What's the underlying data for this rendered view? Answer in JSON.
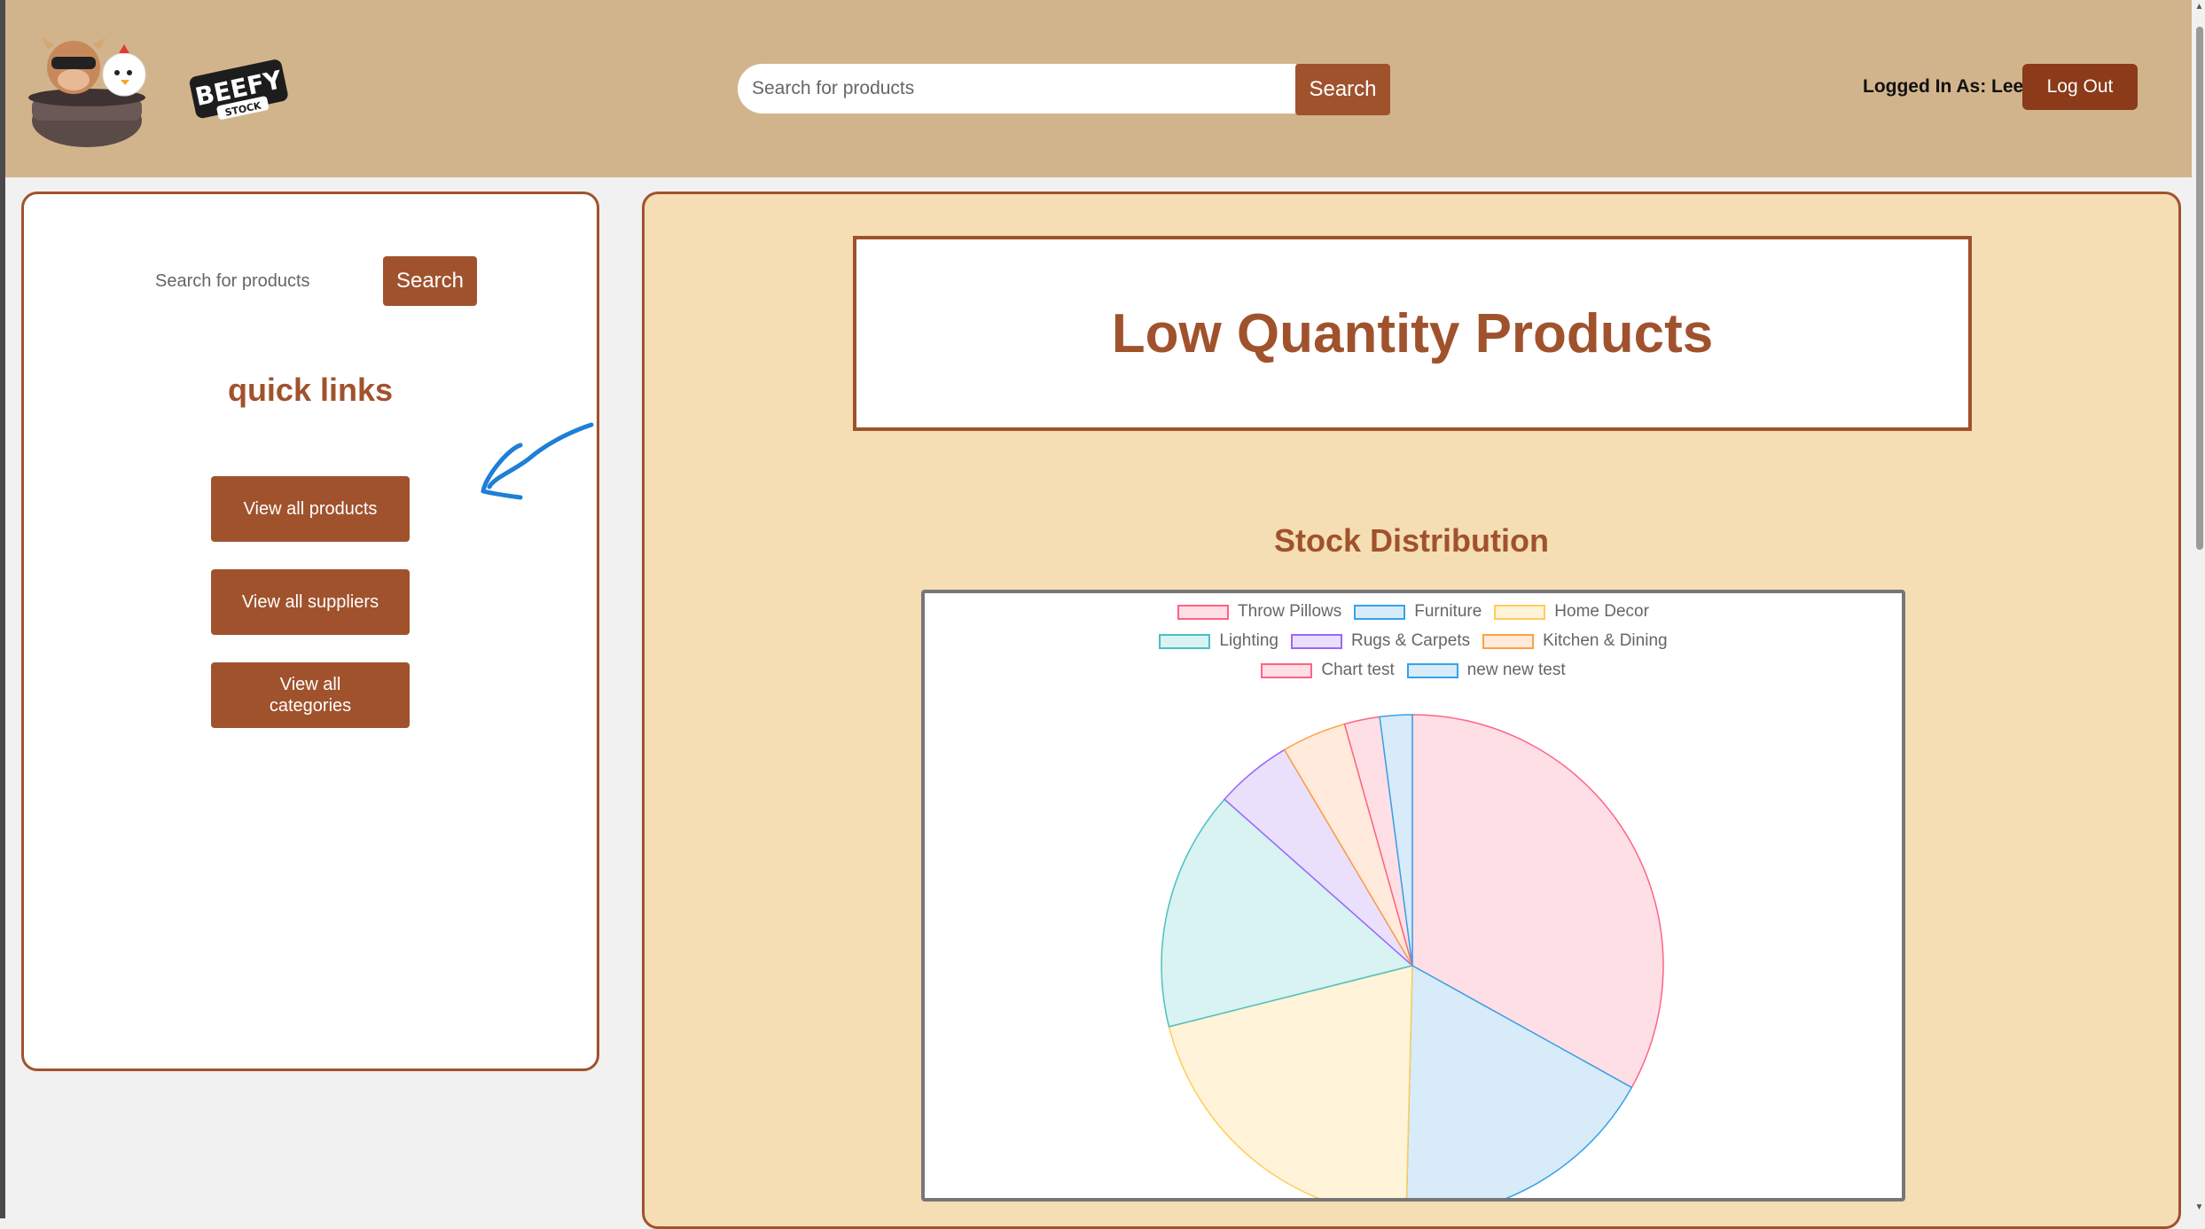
{
  "header": {
    "logo_word": "BEEFY",
    "logo_sub": "STOCK",
    "search_placeholder": "Search for products",
    "search_label": "Search",
    "logged_in_text": "Logged In As: Lee",
    "logout_label": "Log Out"
  },
  "sidebar": {
    "search_placeholder": "Search for products",
    "search_label": "Search",
    "quick_links_title": "quick links",
    "links": [
      {
        "label": "View all products"
      },
      {
        "label": "View all suppliers"
      },
      {
        "label": "View all categories"
      }
    ]
  },
  "main": {
    "page_title": "Low Quantity Products",
    "chart_title": "Stock Distribution"
  },
  "colors": {
    "header_bg": "#d2b48c",
    "brand": "#a0522d",
    "main_bg": "#f5deb3"
  },
  "chart_data": {
    "type": "pie",
    "title": "Stock Distribution",
    "legend_position": "top",
    "categories": [
      "Throw Pillows",
      "Furniture",
      "Home Decor",
      "Lighting",
      "Rugs & Carpets",
      "Kitchen & Dining",
      "Chart test",
      "new new test"
    ],
    "values": [
      33.4,
      17.5,
      20.9,
      15.6,
      5.0,
      4.2,
      2.3,
      2.1
    ],
    "fills": [
      "#ffdfe6",
      "#d8ebf8",
      "#fff3da",
      "#d9f2f2",
      "#ebe0fc",
      "#ffeadb",
      "#ffdfe6",
      "#d8ebf8"
    ],
    "borders": [
      "#ff6384",
      "#36a2eb",
      "#ffcd56",
      "#4bc0c0",
      "#9966ff",
      "#ff9f40",
      "#ff6384",
      "#36a2eb"
    ]
  }
}
